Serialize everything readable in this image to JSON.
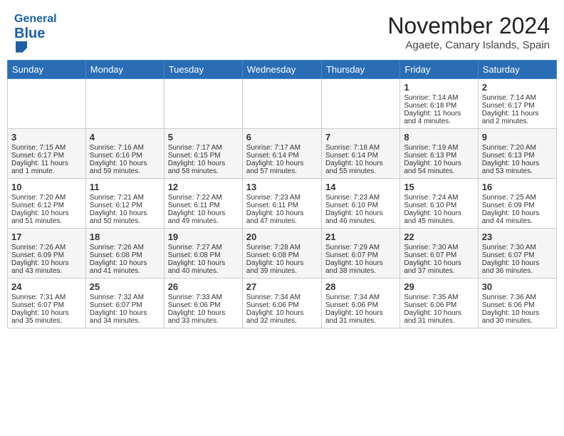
{
  "header": {
    "logo_line1": "General",
    "logo_line2": "Blue",
    "month_year": "November 2024",
    "location": "Agaete, Canary Islands, Spain"
  },
  "weekdays": [
    "Sunday",
    "Monday",
    "Tuesday",
    "Wednesday",
    "Thursday",
    "Friday",
    "Saturday"
  ],
  "weeks": [
    [
      {
        "day": "",
        "info": ""
      },
      {
        "day": "",
        "info": ""
      },
      {
        "day": "",
        "info": ""
      },
      {
        "day": "",
        "info": ""
      },
      {
        "day": "",
        "info": ""
      },
      {
        "day": "1",
        "info": "Sunrise: 7:14 AM\nSunset: 6:18 PM\nDaylight: 11 hours\nand 4 minutes."
      },
      {
        "day": "2",
        "info": "Sunrise: 7:14 AM\nSunset: 6:17 PM\nDaylight: 11 hours\nand 2 minutes."
      }
    ],
    [
      {
        "day": "3",
        "info": "Sunrise: 7:15 AM\nSunset: 6:17 PM\nDaylight: 11 hours\nand 1 minute."
      },
      {
        "day": "4",
        "info": "Sunrise: 7:16 AM\nSunset: 6:16 PM\nDaylight: 10 hours\nand 59 minutes."
      },
      {
        "day": "5",
        "info": "Sunrise: 7:17 AM\nSunset: 6:15 PM\nDaylight: 10 hours\nand 58 minutes."
      },
      {
        "day": "6",
        "info": "Sunrise: 7:17 AM\nSunset: 6:14 PM\nDaylight: 10 hours\nand 57 minutes."
      },
      {
        "day": "7",
        "info": "Sunrise: 7:18 AM\nSunset: 6:14 PM\nDaylight: 10 hours\nand 55 minutes."
      },
      {
        "day": "8",
        "info": "Sunrise: 7:19 AM\nSunset: 6:13 PM\nDaylight: 10 hours\nand 54 minutes."
      },
      {
        "day": "9",
        "info": "Sunrise: 7:20 AM\nSunset: 6:13 PM\nDaylight: 10 hours\nand 53 minutes."
      }
    ],
    [
      {
        "day": "10",
        "info": "Sunrise: 7:20 AM\nSunset: 6:12 PM\nDaylight: 10 hours\nand 51 minutes."
      },
      {
        "day": "11",
        "info": "Sunrise: 7:21 AM\nSunset: 6:12 PM\nDaylight: 10 hours\nand 50 minutes."
      },
      {
        "day": "12",
        "info": "Sunrise: 7:22 AM\nSunset: 6:11 PM\nDaylight: 10 hours\nand 49 minutes."
      },
      {
        "day": "13",
        "info": "Sunrise: 7:23 AM\nSunset: 6:11 PM\nDaylight: 10 hours\nand 47 minutes."
      },
      {
        "day": "14",
        "info": "Sunrise: 7:23 AM\nSunset: 6:10 PM\nDaylight: 10 hours\nand 46 minutes."
      },
      {
        "day": "15",
        "info": "Sunrise: 7:24 AM\nSunset: 6:10 PM\nDaylight: 10 hours\nand 45 minutes."
      },
      {
        "day": "16",
        "info": "Sunrise: 7:25 AM\nSunset: 6:09 PM\nDaylight: 10 hours\nand 44 minutes."
      }
    ],
    [
      {
        "day": "17",
        "info": "Sunrise: 7:26 AM\nSunset: 6:09 PM\nDaylight: 10 hours\nand 43 minutes."
      },
      {
        "day": "18",
        "info": "Sunrise: 7:26 AM\nSunset: 6:08 PM\nDaylight: 10 hours\nand 41 minutes."
      },
      {
        "day": "19",
        "info": "Sunrise: 7:27 AM\nSunset: 6:08 PM\nDaylight: 10 hours\nand 40 minutes."
      },
      {
        "day": "20",
        "info": "Sunrise: 7:28 AM\nSunset: 6:08 PM\nDaylight: 10 hours\nand 39 minutes."
      },
      {
        "day": "21",
        "info": "Sunrise: 7:29 AM\nSunset: 6:07 PM\nDaylight: 10 hours\nand 38 minutes."
      },
      {
        "day": "22",
        "info": "Sunrise: 7:30 AM\nSunset: 6:07 PM\nDaylight: 10 hours\nand 37 minutes."
      },
      {
        "day": "23",
        "info": "Sunrise: 7:30 AM\nSunset: 6:07 PM\nDaylight: 10 hours\nand 36 minutes."
      }
    ],
    [
      {
        "day": "24",
        "info": "Sunrise: 7:31 AM\nSunset: 6:07 PM\nDaylight: 10 hours\nand 35 minutes."
      },
      {
        "day": "25",
        "info": "Sunrise: 7:32 AM\nSunset: 6:07 PM\nDaylight: 10 hours\nand 34 minutes."
      },
      {
        "day": "26",
        "info": "Sunrise: 7:33 AM\nSunset: 6:06 PM\nDaylight: 10 hours\nand 33 minutes."
      },
      {
        "day": "27",
        "info": "Sunrise: 7:34 AM\nSunset: 6:06 PM\nDaylight: 10 hours\nand 32 minutes."
      },
      {
        "day": "28",
        "info": "Sunrise: 7:34 AM\nSunset: 6:06 PM\nDaylight: 10 hours\nand 31 minutes."
      },
      {
        "day": "29",
        "info": "Sunrise: 7:35 AM\nSunset: 6:06 PM\nDaylight: 10 hours\nand 31 minutes."
      },
      {
        "day": "30",
        "info": "Sunrise: 7:36 AM\nSunset: 6:06 PM\nDaylight: 10 hours\nand 30 minutes."
      }
    ]
  ]
}
